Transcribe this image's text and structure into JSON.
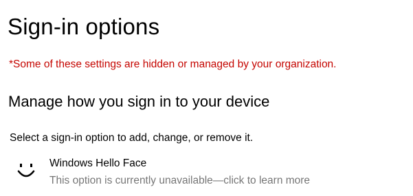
{
  "page": {
    "title": "Sign-in options",
    "warning": "*Some of these settings are hidden or managed by your organization.",
    "section_heading": "Manage how you sign in to your device",
    "description": "Select a sign-in option to add, change, or remove it."
  },
  "options": [
    {
      "icon": "smiley-face-icon",
      "title": "Windows Hello Face",
      "subtitle": "This option is currently unavailable—click to learn more"
    }
  ],
  "colors": {
    "warning": "#c50500",
    "subtitle": "#767676",
    "text": "#000000",
    "background": "#ffffff"
  }
}
